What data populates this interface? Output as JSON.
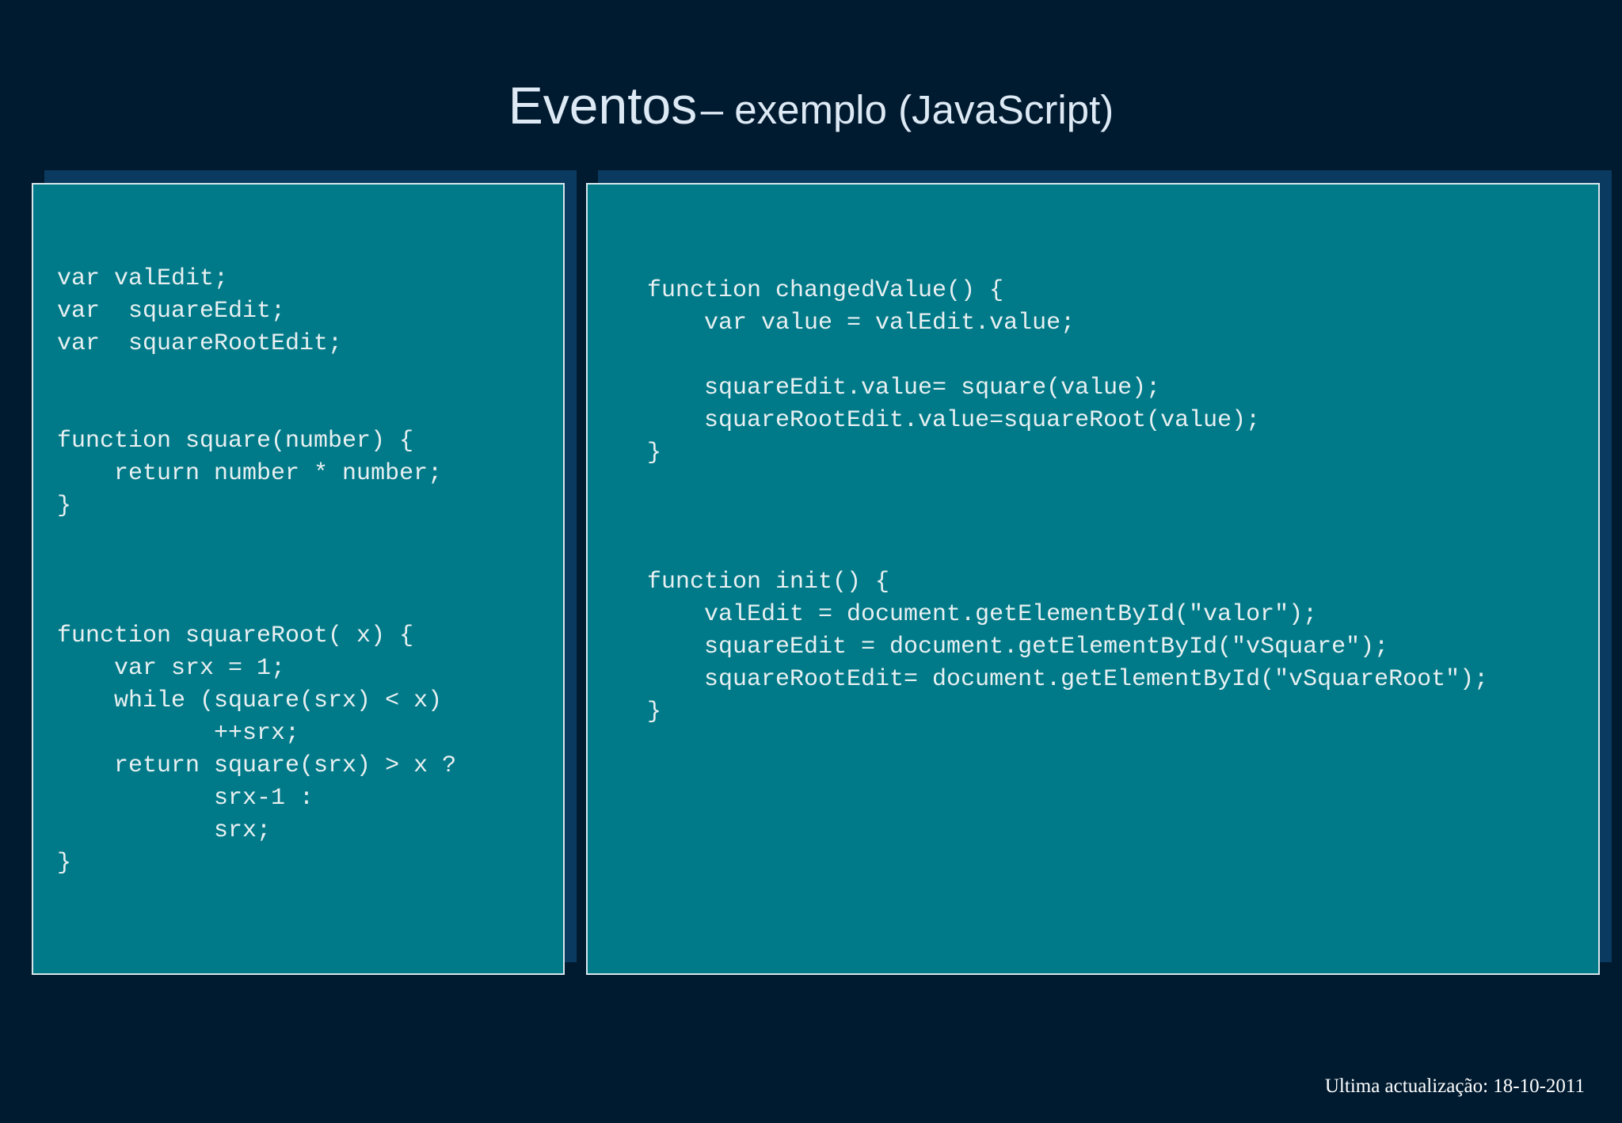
{
  "slide": {
    "title_main": "Eventos",
    "title_sub": "– exemplo (JavaScript)"
  },
  "left_panel": {
    "code": "var valEdit;\nvar  squareEdit;\nvar  squareRootEdit;\n\n\nfunction square(number) {\n    return number * number;\n}\n\n\n\nfunction squareRoot( x) {\n    var srx = 1;\n    while (square(srx) < x)\n           ++srx;\n    return square(srx) > x ?\n           srx-1 :\n           srx;\n}"
  },
  "right_panel": {
    "code_changed_value": "function changedValue() {\n    var value = valEdit.value;\n\n    squareEdit.value= square(value);\n    squareRootEdit.value=squareRoot(value);\n}",
    "code_init": "function init() {\n    valEdit = document.getElementById(\"valor\");\n    squareEdit = document.getElementById(\"vSquare\");\n    squareRootEdit= document.getElementById(\"vSquareRoot\");\n}"
  },
  "footer": {
    "text": "Ultima actualização: 18-10-2011"
  },
  "colors": {
    "background": "#001b30",
    "panel": "#007a88",
    "panel_border": "#d8e6ec",
    "panel_shadow": "#0a3a5f"
  }
}
